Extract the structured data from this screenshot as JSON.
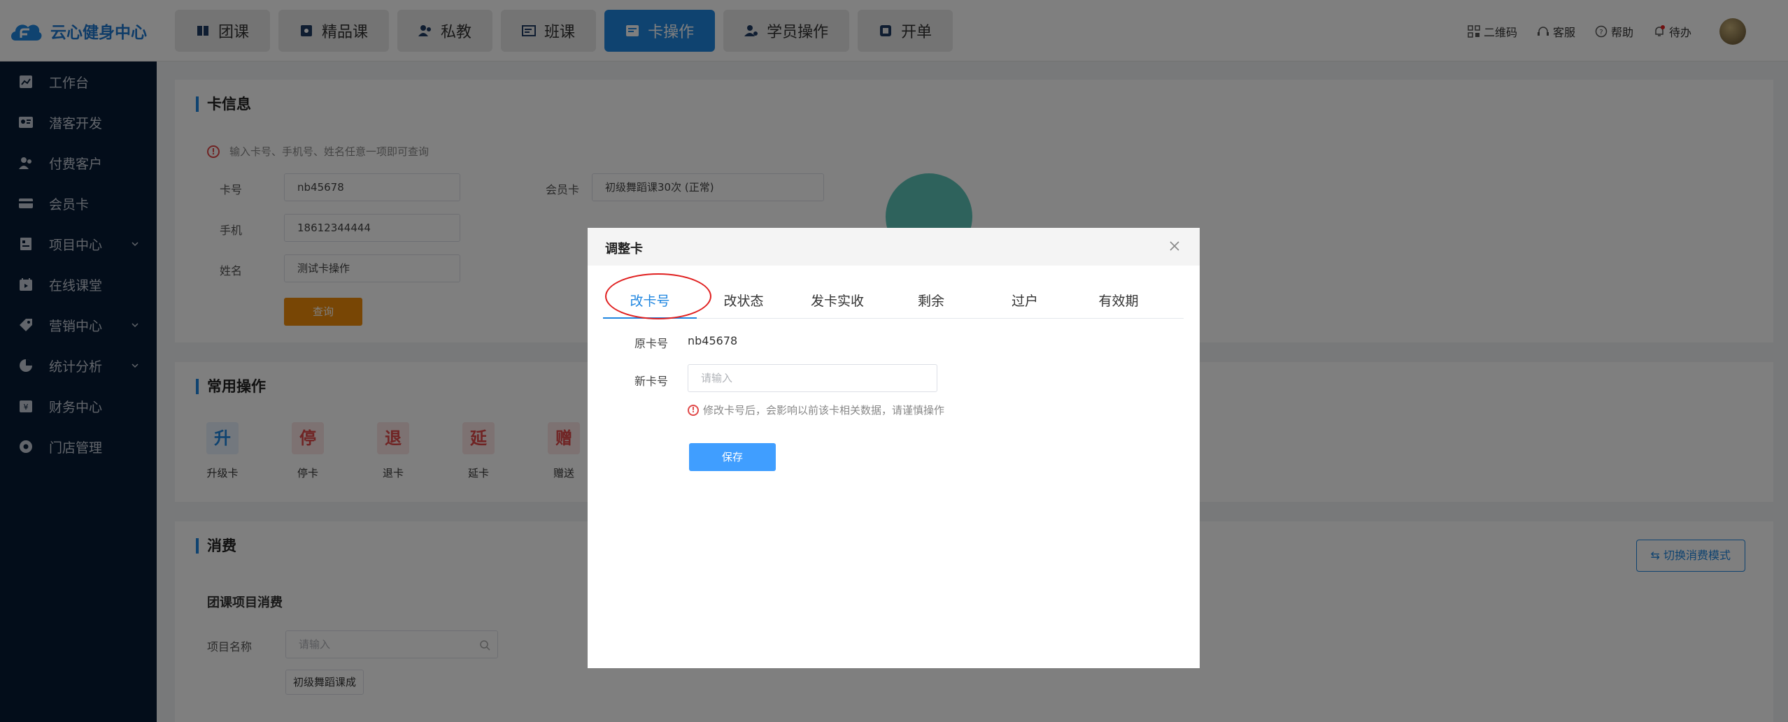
{
  "app": {
    "name": "云心健身中心"
  },
  "topnav": [
    {
      "label": "团课",
      "icon": "book-icon"
    },
    {
      "label": "精品课",
      "icon": "star-box-icon"
    },
    {
      "label": "私教",
      "icon": "user-group-icon"
    },
    {
      "label": "班课",
      "icon": "list-icon"
    },
    {
      "label": "卡操作",
      "icon": "card-icon",
      "active": true
    },
    {
      "label": "学员操作",
      "icon": "user-settings-icon"
    },
    {
      "label": "开单",
      "icon": "receipt-icon"
    }
  ],
  "topright": {
    "qrcode": "二维码",
    "service": "客服",
    "help": "帮助",
    "todo": "待办"
  },
  "sidebar": [
    {
      "label": "工作台",
      "icon": "dashboard-icon"
    },
    {
      "label": "潜客开发",
      "icon": "id-card-icon"
    },
    {
      "label": "付费客户",
      "icon": "users-icon"
    },
    {
      "label": "会员卡",
      "icon": "card-icon"
    },
    {
      "label": "项目中心",
      "icon": "project-icon",
      "expandable": true
    },
    {
      "label": "在线课堂",
      "icon": "calendar-icon"
    },
    {
      "label": "营销中心",
      "icon": "tag-icon",
      "expandable": true
    },
    {
      "label": "统计分析",
      "icon": "pie-chart-icon",
      "expandable": true
    },
    {
      "label": "财务中心",
      "icon": "finance-icon"
    },
    {
      "label": "门店管理",
      "icon": "store-icon"
    }
  ],
  "card_info": {
    "title": "卡信息",
    "tip": "输入卡号、手机号、姓名任意一项即可查询",
    "card_no_label": "卡号",
    "card_no_value": "nb45678",
    "phone_label": "手机",
    "phone_value": "18612344444",
    "name_label": "姓名",
    "name_value": "测试卡操作",
    "member_card_label": "会员卡",
    "member_card_value": "初级舞蹈课30次 (正常)",
    "query_label": "查询"
  },
  "common_ops": {
    "title": "常用操作",
    "items": [
      {
        "badge": "升",
        "label": "升级卡",
        "color": "#1f86e0",
        "bg": "#e6f1fc"
      },
      {
        "badge": "停",
        "label": "停卡",
        "color": "#e04848",
        "bg": "#fbe5e5"
      },
      {
        "badge": "退",
        "label": "退卡",
        "color": "#e04848",
        "bg": "#fbe5e5"
      },
      {
        "badge": "延",
        "label": "延卡",
        "color": "#e04848",
        "bg": "#fbe5e5"
      },
      {
        "badge": "赠",
        "label": "赠送",
        "color": "#e04848",
        "bg": "#fbe5e5"
      }
    ]
  },
  "consume": {
    "title": "消费",
    "switch_label": "⇆ 切换消费模式",
    "sub_title": "团课项目消费",
    "project_label": "项目名称",
    "project_placeholder": "请输入",
    "tag": "初级舞蹈课成"
  },
  "dialog": {
    "title": "调整卡",
    "tabs": [
      "改卡号",
      "改状态",
      "发卡实收",
      "剩余",
      "过户",
      "有效期"
    ],
    "active_tab": 0,
    "orig_label": "原卡号",
    "orig_value": "nb45678",
    "new_label": "新卡号",
    "new_placeholder": "请输入",
    "warning": "修改卡号后，会影响以前该卡相关数据，请谨慎操作",
    "save_label": "保存"
  },
  "colors": {
    "primary": "#1f86e0",
    "sidebar_bg": "#061b35",
    "query_btn": "#f08c0a",
    "save_btn": "#409eff",
    "danger": "#e04848"
  }
}
